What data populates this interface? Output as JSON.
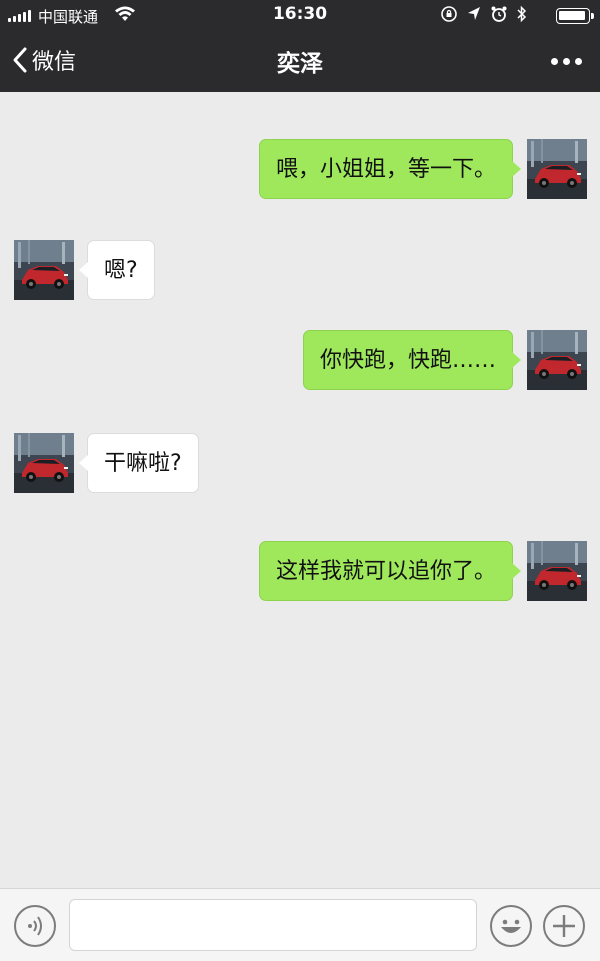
{
  "status_bar": {
    "carrier": "中国联通",
    "time": "16:30",
    "icon_names": [
      "signal-icon",
      "wifi-icon",
      "orientation-lock-icon",
      "location-icon",
      "alarm-icon",
      "bluetooth-icon",
      "battery-icon"
    ]
  },
  "nav": {
    "back_label": "微信",
    "title": "奕泽",
    "more_icon": "more-icon"
  },
  "messages": [
    {
      "side": "out",
      "text": "喂，小姐姐，等一下。"
    },
    {
      "side": "in",
      "text": "嗯?"
    },
    {
      "side": "out",
      "text": "你快跑，快跑……"
    },
    {
      "side": "in",
      "text": "干嘛啦?"
    },
    {
      "side": "out",
      "text": "这样我就可以追你了。"
    }
  ],
  "input_bar": {
    "text_value": "",
    "left_icon": "voice-icon",
    "right_icons": [
      "emoji-icon",
      "plus-icon"
    ]
  },
  "colors": {
    "header_bg": "#2b2b2e",
    "chat_bg": "#ebebeb",
    "out_bubble": "#9fe85c",
    "in_bubble": "#ffffff"
  }
}
